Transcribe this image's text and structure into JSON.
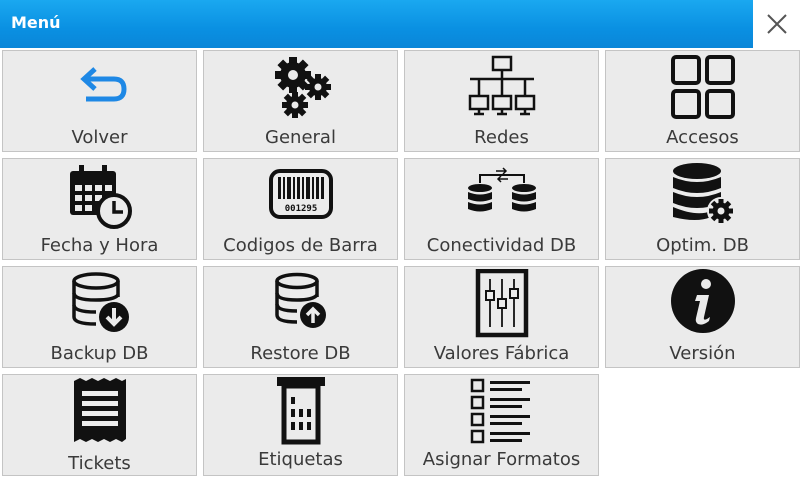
{
  "title": "Menú",
  "close_icon": "close-icon",
  "items": [
    {
      "label": "Volver",
      "icon": "back-arrow-icon"
    },
    {
      "label": "General",
      "icon": "gears-icon"
    },
    {
      "label": "Redes",
      "icon": "network-icon"
    },
    {
      "label": "Accesos",
      "icon": "grid-icon"
    },
    {
      "label": "Fecha y Hora",
      "icon": "calendar-clock-icon"
    },
    {
      "label": "Codigos de Barra",
      "icon": "barcode-icon",
      "barcode_number": "001295"
    },
    {
      "label": "Conectividad DB",
      "icon": "database-sync-icon"
    },
    {
      "label": "Optim. DB",
      "icon": "database-settings-icon"
    },
    {
      "label": "Backup DB",
      "icon": "database-download-icon"
    },
    {
      "label": "Restore DB",
      "icon": "database-upload-icon"
    },
    {
      "label": "Valores Fábrica",
      "icon": "sliders-icon"
    },
    {
      "label": "Versión",
      "icon": "info-icon"
    },
    {
      "label": "Tickets",
      "icon": "receipt-icon"
    },
    {
      "label": "Etiquetas",
      "icon": "label-printer-icon"
    },
    {
      "label": "Asignar Formatos",
      "icon": "checklist-icon"
    }
  ],
  "colors": {
    "titlebar": "#0a90e2",
    "accent_arrow": "#1e88e5",
    "tile_bg": "#ebebeb"
  }
}
